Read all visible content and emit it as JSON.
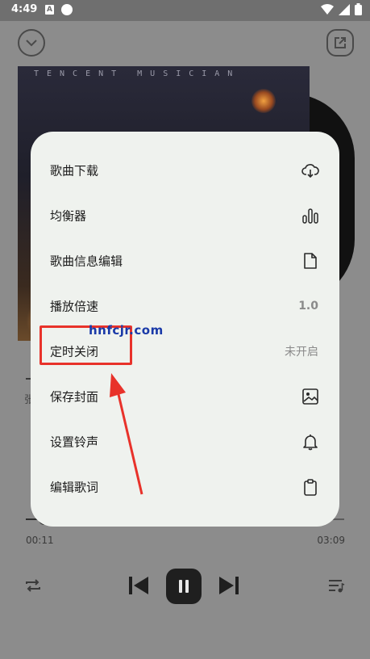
{
  "status_bar": {
    "time": "4:49",
    "notification_letter": "A"
  },
  "player": {
    "album_brand": "TENCENT  MUSICIAN",
    "side_text": "张",
    "current_time": "00:11",
    "total_time": "03:09",
    "progress_fraction": 0.058
  },
  "menu": {
    "items": [
      {
        "label": "歌曲下载",
        "icon": "download-cloud-icon"
      },
      {
        "label": "均衡器",
        "icon": "equalizer-icon"
      },
      {
        "label": "歌曲信息编辑",
        "icon": "document-icon"
      },
      {
        "label": "播放倍速",
        "value": "1.0"
      },
      {
        "label": "定时关闭",
        "value": "未开启"
      },
      {
        "label": "保存封面",
        "icon": "image-icon"
      },
      {
        "label": "设置铃声",
        "icon": "bell-icon"
      },
      {
        "label": "编辑歌词",
        "icon": "clipboard-icon"
      }
    ]
  },
  "overlay": {
    "watermark": "hnfcjr.com",
    "highlight_color": "#e8322a"
  }
}
